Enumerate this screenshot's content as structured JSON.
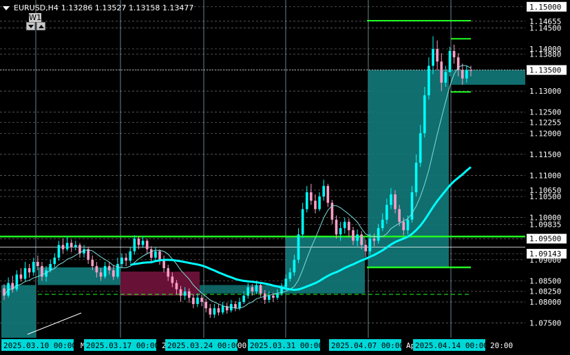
{
  "header": {
    "symbol": "EURUSD,H4",
    "ohlc": "1.13286 1.13527 1.13158 1.13477"
  },
  "widget": {
    "period_label": "W1"
  },
  "colors": {
    "background": "#000000",
    "grid": "#9a9a9a",
    "bull": "#00ffff",
    "bear": "#ff9ec8",
    "green_line": "#22ff22",
    "teal_box": "#127a7a",
    "maroon_box": "#6b1238",
    "price_tag": "#ffffff"
  },
  "price_labels": [
    "1.15000",
    "1.14655",
    "1.14500",
    "1.14000",
    "1.13880",
    "1.13500",
    "1.13000",
    "1.12500",
    "1.12255",
    "1.12000",
    "1.11500",
    "1.11000",
    "1.10650",
    "1.10500",
    "1.10000",
    "1.09835",
    "1.09500",
    "1.09143",
    "1.09000",
    "1.08500",
    "1.08250",
    "1.08000",
    "1.07500"
  ],
  "highlighted_price_labels": [
    "1.15000",
    "1.13500",
    "1.09500",
    "1.09143"
  ],
  "time_labels": [
    {
      "text": "2025.03.10 00:00",
      "tag": true
    },
    {
      "text": "M",
      "tag": false
    },
    {
      "text": "2025.03.17 00:00",
      "tag": true
    },
    {
      "text": "2",
      "tag": false
    },
    {
      "text": "2025.03.24 00:00",
      "tag": true
    },
    {
      "text": "00",
      "tag": false
    },
    {
      "text": "2025.03.31 00:00",
      "tag": true
    },
    {
      "text": "2025.04.07 00:00",
      "tag": true
    },
    {
      "text": "Ap",
      "tag": false
    },
    {
      "text": "2025.04.14 00:00",
      "tag": true
    },
    {
      "text": "20:00",
      "tag": false
    }
  ],
  "chart_data": {
    "type": "candlestick",
    "symbol": "EURUSD",
    "timeframe": "H4",
    "ylim": [
      1.0715,
      1.1516
    ],
    "levels": {
      "support_green": 1.0955,
      "lower_green": 1.0882,
      "green_top": 1.1467,
      "green_small": 1.1424,
      "green_small2": 1.1298,
      "dashed_green": 1.0818,
      "white_line": 1.093,
      "current_price": 1.135
    },
    "candles": [
      [
        1.0832,
        1.0815,
        1.0842,
        1.0805
      ],
      [
        1.0815,
        1.0845,
        1.0858,
        1.081
      ],
      [
        1.0845,
        1.083,
        1.0862,
        1.0822
      ],
      [
        1.083,
        1.0865,
        1.0875,
        1.0825
      ],
      [
        1.0865,
        1.0855,
        1.088,
        1.0848
      ],
      [
        1.0855,
        1.088,
        1.0895,
        1.085
      ],
      [
        1.088,
        1.087,
        1.089,
        1.0858
      ],
      [
        1.087,
        1.0895,
        1.0905,
        1.0862
      ],
      [
        1.0895,
        1.0885,
        1.091,
        1.0875
      ],
      [
        1.0885,
        1.086,
        1.0895,
        1.085
      ],
      [
        1.086,
        1.0875,
        1.0885,
        1.0848
      ],
      [
        1.0875,
        1.089,
        1.09,
        1.087
      ],
      [
        1.089,
        1.0905,
        1.0915,
        1.0882
      ],
      [
        1.0905,
        1.0935,
        1.0945,
        1.0898
      ],
      [
        1.0935,
        1.0925,
        1.095,
        1.0915
      ],
      [
        1.0925,
        1.094,
        1.0955,
        1.092
      ],
      [
        1.094,
        1.093,
        1.0948,
        1.0918
      ],
      [
        1.093,
        1.0935,
        1.0945,
        1.0922
      ],
      [
        1.0935,
        1.0915,
        1.094,
        1.0905
      ],
      [
        1.0915,
        1.0925,
        1.0935,
        1.0905
      ],
      [
        1.0925,
        1.09,
        1.093,
        1.089
      ],
      [
        1.09,
        1.0885,
        1.091,
        1.0875
      ],
      [
        1.0885,
        1.087,
        1.0895,
        1.0858
      ],
      [
        1.087,
        1.086,
        1.088,
        1.085
      ],
      [
        1.086,
        1.0885,
        1.0895,
        1.0855
      ],
      [
        1.0885,
        1.0875,
        1.0895,
        1.0865
      ],
      [
        1.0875,
        1.086,
        1.0888,
        1.0852
      ],
      [
        1.086,
        1.089,
        1.0905,
        1.0855
      ],
      [
        1.089,
        1.0905,
        1.0915,
        1.088
      ],
      [
        1.0905,
        1.0898,
        1.0915,
        1.0885
      ],
      [
        1.0898,
        1.092,
        1.093,
        1.0892
      ],
      [
        1.092,
        1.095,
        1.0958,
        1.0912
      ],
      [
        1.095,
        1.0935,
        1.0955,
        1.0925
      ],
      [
        1.0935,
        1.0945,
        1.0955,
        1.0928
      ],
      [
        1.0945,
        1.0925,
        1.095,
        1.0915
      ],
      [
        1.0925,
        1.0905,
        1.0932,
        1.0895
      ],
      [
        1.0905,
        1.092,
        1.093,
        1.0895
      ],
      [
        1.092,
        1.09,
        1.0925,
        1.0888
      ],
      [
        1.09,
        1.088,
        1.091,
        1.087
      ],
      [
        1.088,
        1.086,
        1.0888,
        1.085
      ],
      [
        1.086,
        1.0845,
        1.087,
        1.0835
      ],
      [
        1.0845,
        1.083,
        1.0852,
        1.0818
      ],
      [
        1.083,
        1.0815,
        1.0838,
        1.08
      ],
      [
        1.0815,
        1.0825,
        1.0835,
        1.0805
      ],
      [
        1.0825,
        1.081,
        1.0832,
        1.0798
      ],
      [
        1.081,
        1.0795,
        1.0818,
        1.0785
      ],
      [
        1.0795,
        1.081,
        1.082,
        1.0788
      ],
      [
        1.081,
        1.08,
        1.0818,
        1.079
      ],
      [
        1.08,
        1.0785,
        1.0808,
        1.0775
      ],
      [
        1.0785,
        1.077,
        1.0795,
        1.0762
      ],
      [
        1.077,
        1.0785,
        1.0795,
        1.0762
      ],
      [
        1.0785,
        1.0775,
        1.0795,
        1.0768
      ],
      [
        1.0775,
        1.079,
        1.08,
        1.077
      ],
      [
        1.079,
        1.078,
        1.0798,
        1.0772
      ],
      [
        1.078,
        1.0795,
        1.0805,
        1.0775
      ],
      [
        1.0795,
        1.0785,
        1.0802,
        1.0778
      ],
      [
        1.0785,
        1.08,
        1.081,
        1.078
      ],
      [
        1.08,
        1.0815,
        1.0825,
        1.0795
      ],
      [
        1.0815,
        1.0835,
        1.0845,
        1.0808
      ],
      [
        1.0835,
        1.0825,
        1.0842,
        1.0815
      ],
      [
        1.0825,
        1.084,
        1.085,
        1.0818
      ],
      [
        1.084,
        1.082,
        1.0845,
        1.0812
      ],
      [
        1.082,
        1.0805,
        1.0828,
        1.0795
      ],
      [
        1.0805,
        1.0815,
        1.0825,
        1.0798
      ],
      [
        1.0815,
        1.081,
        1.0822,
        1.08
      ],
      [
        1.081,
        1.082,
        1.083,
        1.0805
      ],
      [
        1.082,
        1.0835,
        1.0845,
        1.0815
      ],
      [
        1.0835,
        1.0855,
        1.0865,
        1.0828
      ],
      [
        1.0855,
        1.087,
        1.088,
        1.0848
      ],
      [
        1.087,
        1.09,
        1.0912,
        1.0862
      ],
      [
        1.09,
        1.096,
        1.0975,
        1.0892
      ],
      [
        1.096,
        1.102,
        1.1035,
        1.0952
      ],
      [
        1.102,
        1.106,
        1.1075,
        1.1012
      ],
      [
        1.106,
        1.104,
        1.108,
        1.103
      ],
      [
        1.104,
        1.102,
        1.1055,
        1.101
      ],
      [
        1.102,
        1.105,
        1.106,
        1.1015
      ],
      [
        1.105,
        1.1075,
        1.109,
        1.104
      ],
      [
        1.1075,
        1.1035,
        1.108,
        1.1025
      ],
      [
        1.1035,
        1.0995,
        1.1042,
        1.0985
      ],
      [
        1.0995,
        1.096,
        1.1005,
        1.095
      ],
      [
        1.096,
        1.0975,
        1.099,
        1.0945
      ],
      [
        1.0975,
        1.099,
        1.1,
        1.0962
      ],
      [
        1.099,
        1.097,
        1.0998,
        1.0955
      ],
      [
        1.097,
        1.0945,
        1.0978,
        1.0935
      ],
      [
        1.0945,
        1.096,
        1.0972,
        1.0932
      ],
      [
        1.096,
        1.0935,
        1.0968,
        1.0925
      ],
      [
        1.0935,
        1.092,
        1.0948,
        1.0905
      ],
      [
        1.092,
        1.095,
        1.0962,
        1.0912
      ],
      [
        1.095,
        1.0945,
        1.0962,
        1.0932
      ],
      [
        1.0945,
        1.0975,
        1.0985,
        1.0938
      ],
      [
        1.0975,
        1.0995,
        1.101,
        1.0968
      ],
      [
        1.0995,
        1.103,
        1.1045,
        1.0985
      ],
      [
        1.103,
        1.1055,
        1.107,
        1.102
      ],
      [
        1.1055,
        1.102,
        1.1065,
        1.101
      ],
      [
        1.102,
        1.099,
        1.103,
        1.098
      ],
      [
        1.099,
        1.097,
        1.1,
        1.0958
      ],
      [
        1.097,
        1.0995,
        1.1005,
        1.096
      ],
      [
        1.0995,
        1.106,
        1.1075,
        1.0988
      ],
      [
        1.106,
        1.113,
        1.115,
        1.105
      ],
      [
        1.113,
        1.12,
        1.122,
        1.112
      ],
      [
        1.12,
        1.129,
        1.131,
        1.119
      ],
      [
        1.129,
        1.136,
        1.138,
        1.128
      ],
      [
        1.136,
        1.14,
        1.143,
        1.134
      ],
      [
        1.14,
        1.137,
        1.142,
        1.135
      ],
      [
        1.137,
        1.132,
        1.139,
        1.13
      ],
      [
        1.132,
        1.1345,
        1.136,
        1.131
      ],
      [
        1.1345,
        1.1395,
        1.1405,
        1.1335
      ],
      [
        1.1395,
        1.138,
        1.141,
        1.1365
      ],
      [
        1.138,
        1.135,
        1.139,
        1.1335
      ],
      [
        1.135,
        1.133,
        1.1365,
        1.1315
      ],
      [
        1.133,
        1.135,
        1.136,
        1.132
      ],
      [
        1.135,
        1.1348,
        1.136,
        1.1335
      ]
    ]
  }
}
